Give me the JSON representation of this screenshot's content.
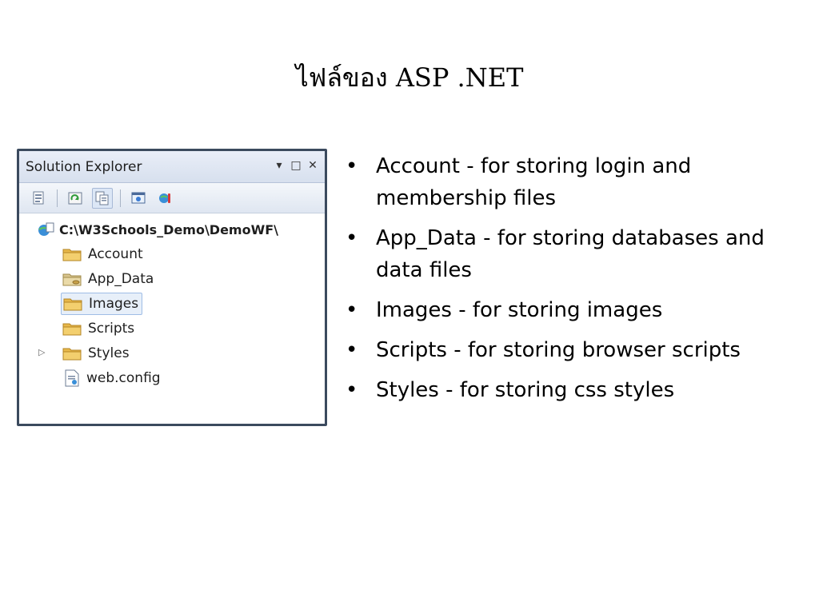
{
  "slide": {
    "title": "ไฟล์ของ ASP .NET"
  },
  "solution_explorer": {
    "title": "Solution Explorer",
    "window_buttons": [
      "▾",
      "□",
      "✕"
    ],
    "toolbar_icons": [
      "properties-icon",
      "refresh-icon",
      "show-all-files-icon",
      "view-in-browser-icon",
      "copy-website-icon"
    ],
    "root": {
      "label": "C:\\W3Schools_Demo\\DemoWF\\",
      "icon": "web-project-icon"
    },
    "items": [
      {
        "label": "Account",
        "icon": "folder-icon"
      },
      {
        "label": "App_Data",
        "icon": "folder-data-icon"
      },
      {
        "label": "Images",
        "icon": "folder-icon",
        "selected": true
      },
      {
        "label": "Scripts",
        "icon": "folder-icon"
      },
      {
        "label": "Styles",
        "icon": "folder-icon",
        "expandable": true
      },
      {
        "label": "web.config",
        "icon": "config-file-icon"
      }
    ],
    "colors": {
      "border": "#3b4a5e",
      "title_bg": "#dce4f1",
      "folder": "#e8b84a",
      "selection": "#e7eff9"
    }
  },
  "bullets": [
    {
      "text": "Account - for storing login and membership files"
    },
    {
      "text": "App_Data - for storing databases and data files"
    },
    {
      "text": "Images - for storing images"
    },
    {
      "text": "Scripts - for storing browser scripts"
    },
    {
      "text": "Styles - for storing css styles"
    }
  ]
}
